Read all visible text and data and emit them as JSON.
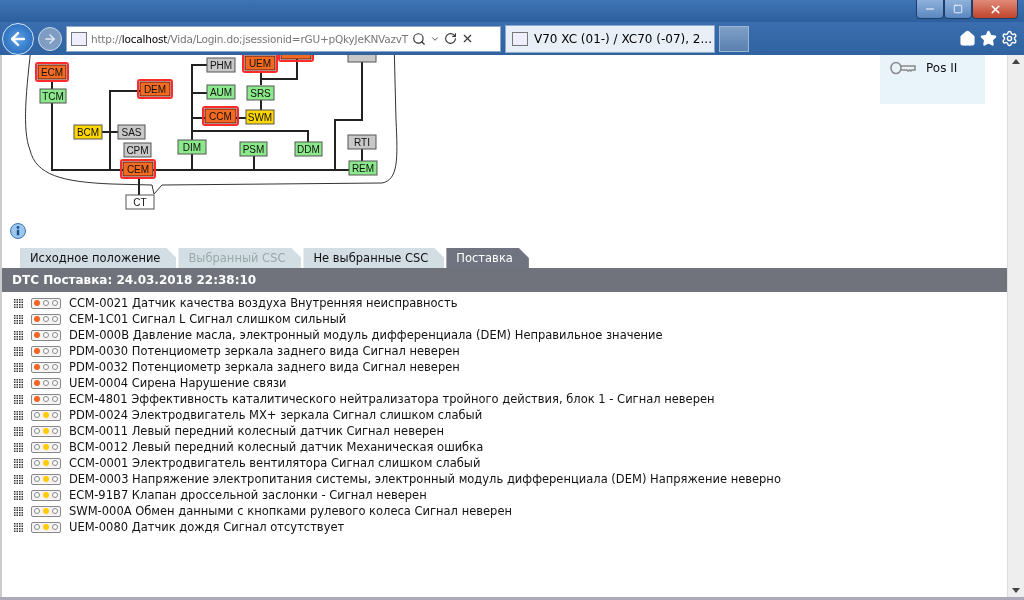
{
  "browser": {
    "address": "http://**localhost**/Vida/Login.do;jsessionid=rGU+pQkyJeKNVazvT",
    "tab_title": "V70 XC (01-) / XC70 (-07), 2..."
  },
  "diagram": {
    "nodes": [
      {
        "label": "ECM",
        "kind": "fault"
      },
      {
        "label": "TCM",
        "kind": "ok"
      },
      {
        "label": "DEM",
        "kind": "fault"
      },
      {
        "label": "PHM",
        "kind": "unknown"
      },
      {
        "label": "UEM",
        "kind": "fault"
      },
      {
        "kind": "fault"
      },
      {
        "kind": "unknown"
      },
      {
        "label": "AUM",
        "kind": "ok"
      },
      {
        "label": "SRS",
        "kind": "ok"
      },
      {
        "label": "CCM",
        "kind": "fault"
      },
      {
        "label": "SWM",
        "kind": "warning"
      },
      {
        "label": "BCM",
        "kind": "warning"
      },
      {
        "label": "SAS",
        "kind": "unknown"
      },
      {
        "label": "CPM",
        "kind": "unknown"
      },
      {
        "label": "CEM",
        "kind": "fault"
      },
      {
        "label": "CT",
        "kind": "plain"
      },
      {
        "label": "DIM",
        "kind": "ok"
      },
      {
        "label": "PSM",
        "kind": "ok"
      },
      {
        "label": "DDM",
        "kind": "ok"
      },
      {
        "label": "RTI",
        "kind": "unknown"
      },
      {
        "label": "REM",
        "kind": "ok"
      }
    ]
  },
  "ignition": {
    "position": "Pos II"
  },
  "tabs": [
    {
      "label": "Исходное положение",
      "selected": false,
      "disabled": false
    },
    {
      "label": "Выбранный CSC",
      "selected": false,
      "disabled": true
    },
    {
      "label": "Не выбранные CSC",
      "selected": false,
      "disabled": false
    },
    {
      "label": "Поставка",
      "selected": true,
      "disabled": false
    }
  ],
  "header": "DTC Поставка: 24.03.2018 22:38:10",
  "rows": [
    {
      "kind": "fault",
      "color": "#f26522",
      "text": "CCM-0021 Датчик качества воздуха Внутренняя неисправность"
    },
    {
      "kind": "fault",
      "color": "#f26522",
      "text": "CEM-1C01 Сигнал L Сигнал слишком сильный"
    },
    {
      "kind": "fault",
      "color": "#f26522",
      "text": "DEM-000B Давление масла, электронный модуль дифференциала (DEM) Неправильное значение"
    },
    {
      "kind": "fault",
      "color": "#f26522",
      "text": "PDM-0030 Потенциометр зеркала заднего вида Сигнал неверен"
    },
    {
      "kind": "fault",
      "color": "#f26522",
      "text": "PDM-0032 Потенциометр зеркала заднего вида Сигнал неверен"
    },
    {
      "kind": "fault",
      "color": "#f26522",
      "text": "UEM-0004 Сирена Нарушение связи"
    },
    {
      "kind": "fault",
      "color": "#f26522",
      "text": "ECM-4801 Эффективность каталитического нейтрализатора тройного действия, блок 1 - Сигнал неверен"
    },
    {
      "kind": "warning",
      "color": "#ffcc00",
      "text": "PDM-0024 Электродвигатель MX+ зеркала Сигнал слишком слабый"
    },
    {
      "kind": "warning",
      "color": "#ffcc00",
      "text": "BCM-0011 Левый передний колесный датчик Сигнал неверен"
    },
    {
      "kind": "warning",
      "color": "#ffcc00",
      "text": "BCM-0012 Левый передний колесный датчик Механическая ошибка"
    },
    {
      "kind": "warning",
      "color": "#ffcc00",
      "text": "CCM-0001 Электродвигатель вентилятора Сигнал слишком слабый"
    },
    {
      "kind": "warning",
      "color": "#ffcc00",
      "text": "DEM-0003 Напряжение электропитания системы, электронный модуль дифференциала (DEM) Напряжение неверно"
    },
    {
      "kind": "warning",
      "color": "#ffcc00",
      "text": "ECM-91B7 Клапан дроссельной заслонки - Сигнал неверен"
    },
    {
      "kind": "warning",
      "color": "#ffcc00",
      "text": "SWM-000A Обмен данными с кнопками рулевого колеса Сигнал неверен"
    },
    {
      "kind": "warning",
      "color": "#ffcc00",
      "text": "UEM-0080 Датчик дождя Сигнал отсутствует"
    }
  ]
}
